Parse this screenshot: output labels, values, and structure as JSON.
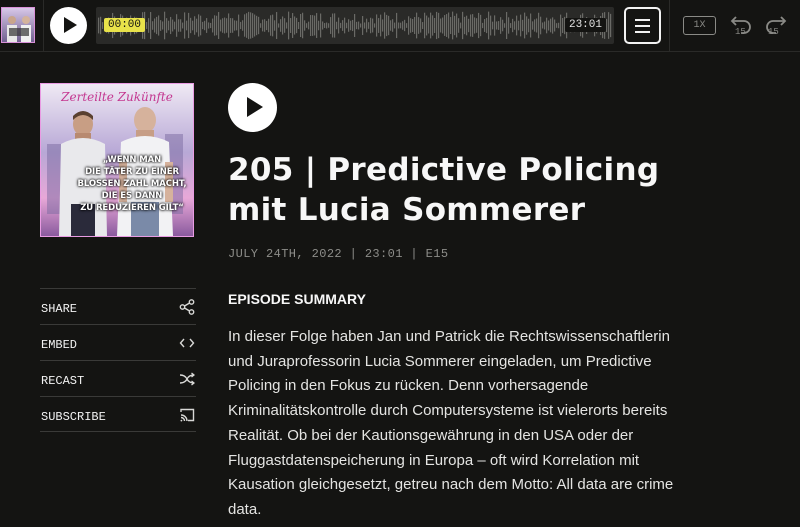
{
  "player": {
    "current_time": "00:00",
    "total_time": "23:01",
    "speed": "1X",
    "skip_back": "15",
    "skip_forward": "15"
  },
  "cover": {
    "title": "Zerteilte Zukünfte",
    "quote_lines": [
      "„WENN MAN",
      "DIE TÄTER ZU EINER",
      "BLOSSEN ZAHL MACHT,",
      "DIE ES DANN",
      "ZU REDUZIEREN GILT“"
    ]
  },
  "actions": [
    {
      "label": "SHARE",
      "icon": "share-icon"
    },
    {
      "label": "EMBED",
      "icon": "code-icon"
    },
    {
      "label": "RECAST",
      "icon": "recast-icon"
    },
    {
      "label": "SUBSCRIBE",
      "icon": "cast-icon"
    }
  ],
  "episode": {
    "title_line1": "205 | Predictive Policing",
    "title_line2": "mit Lucia Sommerer",
    "meta": "JULY 24TH, 2022 | 23:01 | E15",
    "summary_heading": "EPISODE SUMMARY",
    "summary_lines": [
      "In dieser Folge haben Jan und Patrick die Rechtswissenschaftlerin",
      "und Juraprofessorin Lucia Sommerer eingeladen, um Predictive",
      "Policing in den Fokus zu rücken. Denn vorhersagende",
      "Kriminalitätskontrolle durch Computersysteme ist vielerorts bereits",
      "Realität. Ob bei der Kautionsgewährung in den USA oder der",
      "Fluggastdatenspeicherung in Europa – oft wird Korrelation mit",
      "Kausation gleichgesetzt, getreu nach dem Motto: All data are crime",
      "data."
    ]
  },
  "colors": {
    "background": "#141412",
    "accent_time": "#e8e24a",
    "cover_border": "#e99be3",
    "muted": "#8d8d89"
  }
}
